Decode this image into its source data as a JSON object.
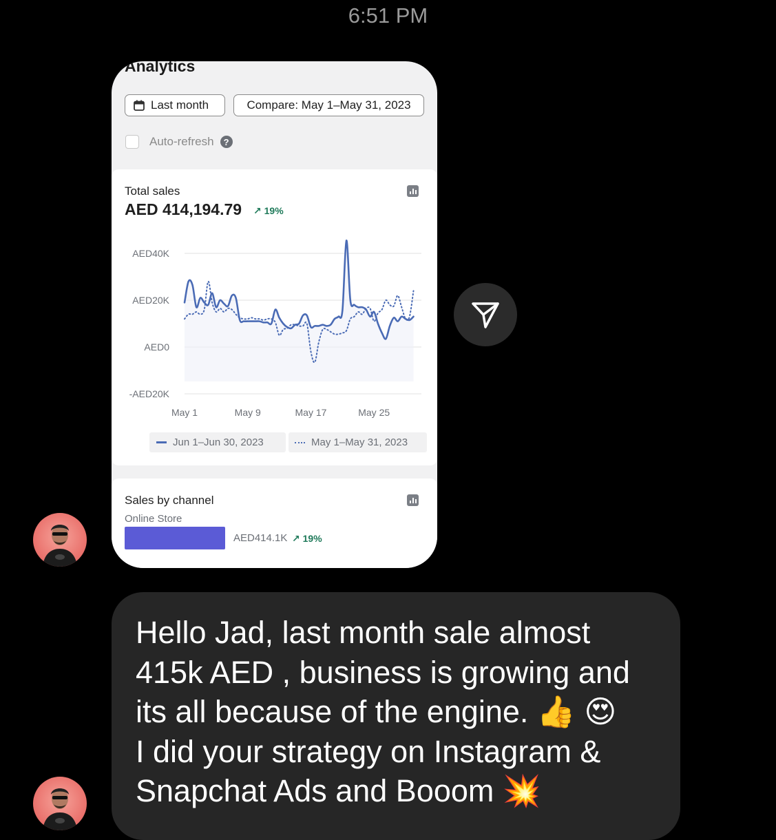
{
  "timestamp": "6:51 PM",
  "analytics": {
    "title": "Analytics",
    "date_range_button": "Last month",
    "compare_button": "Compare: May 1–May 31, 2023",
    "auto_refresh_label": "Auto-refresh",
    "auto_refresh_checked": false,
    "help_icon": "question-circle-icon"
  },
  "total_sales": {
    "label": "Total sales",
    "value": "AED 414,194.79",
    "delta": "19%"
  },
  "sales_by_channel": {
    "label": "Sales by channel",
    "channel_name": "Online Store",
    "channel_value": "AED414.1K",
    "delta": "19%",
    "bar_color": "#5b5bd6"
  },
  "chart_data": {
    "type": "line",
    "title": "Total sales",
    "y_tick_labels": [
      "AED40K",
      "AED20K",
      "AED0",
      "-AED20K"
    ],
    "ylim": [
      -20000,
      40000
    ],
    "x_tick_labels": [
      "May 1",
      "May 9",
      "May 17",
      "May 25"
    ],
    "x_ticks": [
      1,
      9,
      17,
      25
    ],
    "xlim": [
      1,
      31
    ],
    "grid": true,
    "legend_position": "bottom",
    "series": [
      {
        "name": "Jun 1–Jun 30, 2023",
        "style": "solid",
        "color": "#4a6bb5",
        "x": [
          1,
          1.5,
          2,
          2.5,
          3,
          3.5,
          4,
          4.5,
          5,
          5.5,
          6,
          6.5,
          7,
          7.5,
          8,
          8.5,
          9,
          9.5,
          10,
          10.5,
          11,
          11.5,
          12,
          12.5,
          13,
          13.5,
          14,
          14.5,
          15,
          15.5,
          16,
          16.5,
          17,
          17.5,
          18,
          18.5,
          19,
          19.5,
          20,
          20.5,
          21,
          21.5,
          22,
          22.5,
          23,
          23.5,
          24,
          24.5,
          25,
          25.5,
          26,
          26.5,
          27,
          27.5,
          28,
          28.5,
          29,
          29.5,
          30
        ],
        "values": [
          19000,
          28000,
          26500,
          17000,
          21000,
          19000,
          18000,
          23000,
          17000,
          20000,
          18500,
          17500,
          22000,
          21000,
          11500,
          11000,
          11000,
          11000,
          11000,
          11000,
          10500,
          10500,
          10000,
          16000,
          12500,
          10000,
          8500,
          8000,
          9500,
          10000,
          13500,
          13500,
          8500,
          9000,
          9000,
          9500,
          9000,
          9500,
          12000,
          13000,
          15500,
          45500,
          20000,
          18000,
          17000,
          17000,
          16000,
          13000,
          15000,
          10000,
          6000,
          3500,
          9000,
          12500,
          11000,
          13000,
          12000,
          11500,
          13000
        ]
      },
      {
        "name": "May 1–May 31, 2023",
        "style": "dotted",
        "color": "#4a6bb5",
        "x": [
          1,
          1.5,
          2,
          2.5,
          3,
          3.5,
          4,
          4.5,
          5,
          5.5,
          6,
          6.5,
          7,
          7.5,
          8,
          8.5,
          9,
          9.5,
          10,
          10.5,
          11,
          11.5,
          12,
          12.5,
          13,
          13.5,
          14,
          14.5,
          15,
          15.5,
          16,
          16.5,
          17,
          17.5,
          18,
          18.5,
          19,
          19.5,
          20,
          20.5,
          21,
          21.5,
          22,
          22.5,
          23,
          23.5,
          24,
          24.5,
          25,
          25.5,
          26,
          26.5,
          27,
          27.5,
          28,
          28.5,
          29,
          29.5,
          30
        ],
        "values": [
          12000,
          14000,
          14000,
          15000,
          14000,
          16000,
          28000,
          19000,
          15000,
          16500,
          15000,
          16500,
          16000,
          14000,
          12500,
          12000,
          12000,
          12500,
          12000,
          12000,
          11500,
          12000,
          12000,
          10500,
          5000,
          7500,
          8000,
          9500,
          9500,
          9000,
          9000,
          10000,
          -2000,
          -6500,
          2000,
          7500,
          7500,
          6500,
          5500,
          5500,
          6000,
          7000,
          12000,
          13000,
          15000,
          14000,
          16500,
          16500,
          11000,
          14500,
          16000,
          20000,
          18000,
          17500,
          22000,
          17000,
          12000,
          13000,
          24000
        ]
      }
    ]
  }
}
